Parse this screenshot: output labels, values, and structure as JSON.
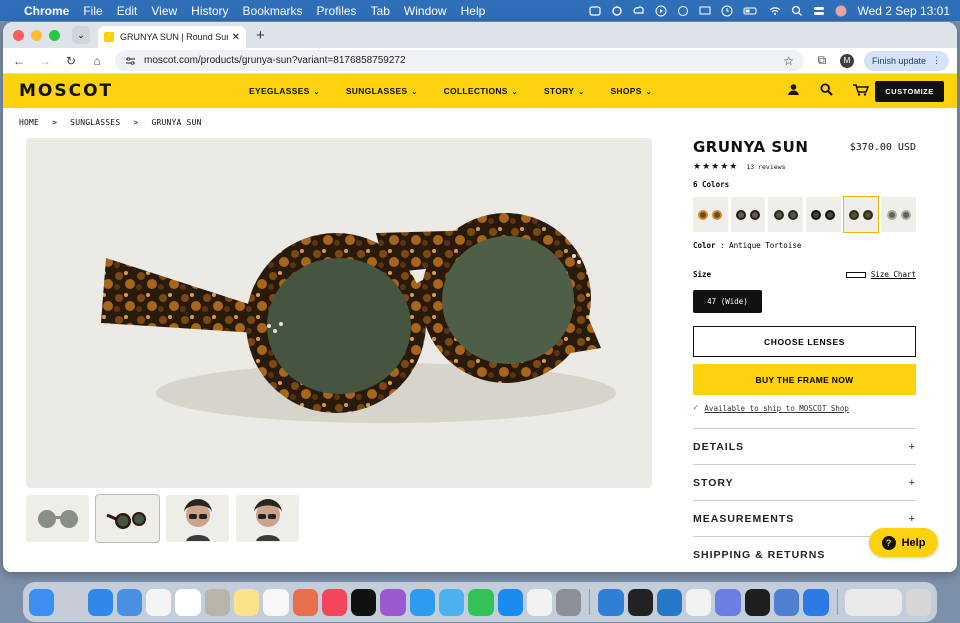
{
  "menubar": {
    "app": "Chrome",
    "items": [
      "File",
      "Edit",
      "View",
      "History",
      "Bookmarks",
      "Profiles",
      "Tab",
      "Window",
      "Help"
    ],
    "datetime": "Wed 2 Sep  13:01"
  },
  "browser": {
    "tab_title": "GRUNYA SUN | Round Sunglasses",
    "url": "moscot.com/products/grunya-sun?variant=8176858759272",
    "profile_initial": "M",
    "finish_update": "Finish update"
  },
  "site": {
    "logo": "MOSCOT",
    "nav": [
      "EYEGLASSES",
      "SUNGLASSES",
      "COLLECTIONS",
      "STORY",
      "SHOPS"
    ],
    "customize": "CUSTOMIZE"
  },
  "breadcrumb": [
    "HOME",
    ">",
    "SUNGLASSES",
    ">",
    "GRUNYA SUN"
  ],
  "product": {
    "title": "GRUNYA SUN",
    "price": "$370.00 USD",
    "stars": "★★★★★",
    "rating": 5,
    "reviews": "13 reviews",
    "colors_label": "6 Colors",
    "color_label": "Color",
    "color_sep": ":",
    "color_value": "Antique Tortoise",
    "size_label": "Size",
    "size_chart": "Size Chart",
    "size_option": "47 (Wide)",
    "choose_lenses": "CHOOSE LENSES",
    "buy_frame": "BUY THE FRAME NOW",
    "ship_note": "Available to ship to MOSCOT Shop",
    "accordion": [
      "DETAILS",
      "STORY",
      "MEASUREMENTS",
      "SHIPPING & RETURNS"
    ]
  },
  "help": "Help",
  "colors": {
    "brand_yellow": "#fcd20f",
    "black": "#111111"
  }
}
